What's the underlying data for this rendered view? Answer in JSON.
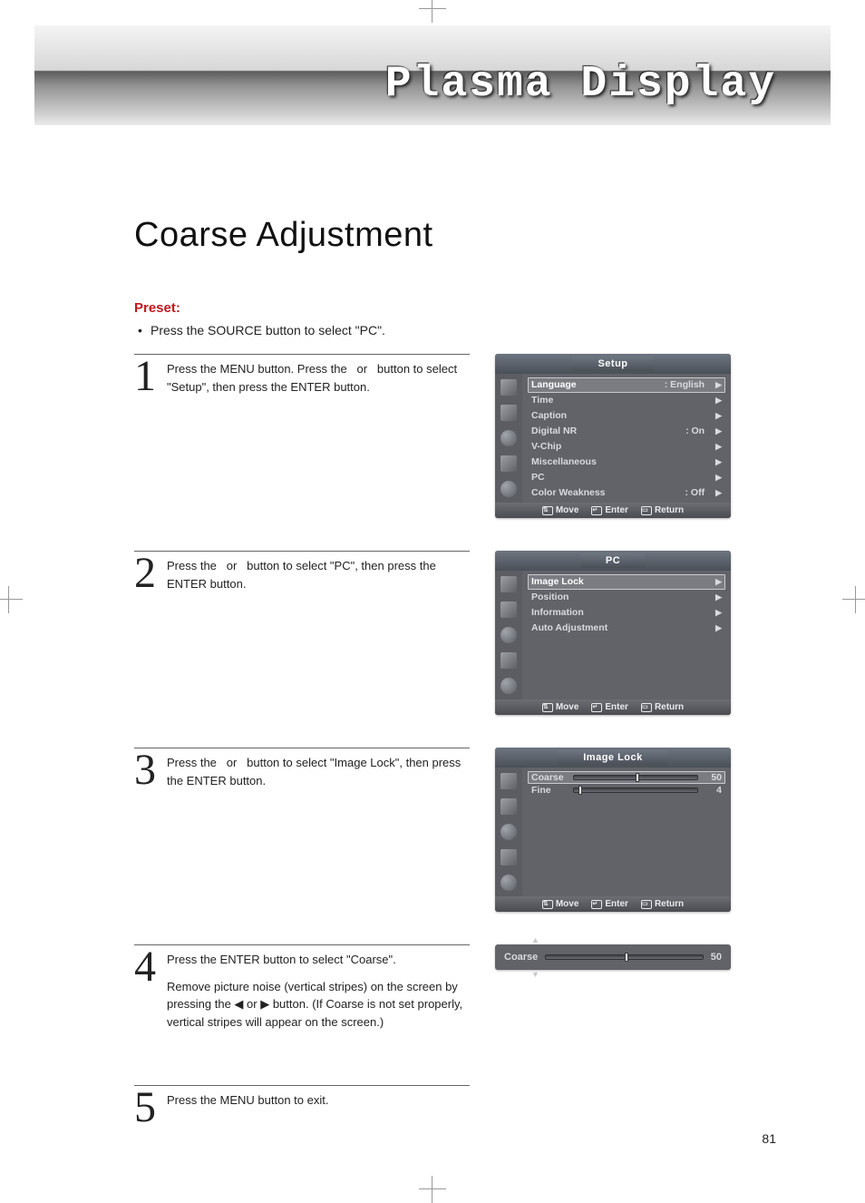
{
  "header": {
    "brand_text": "Plasma Display"
  },
  "section_title": "Coarse Adjustment",
  "preset": {
    "label": "Preset:",
    "text": "Press the SOURCE button to select \"PC\"."
  },
  "steps": [
    {
      "num": "1",
      "text": "Press the MENU button. Press the   or   button to select \"Setup\", then press the ENTER button."
    },
    {
      "num": "2",
      "text": "Press the   or   button to select \"PC\", then press the ENTER button."
    },
    {
      "num": "3",
      "text": "Press the   or   button to select \"Image Lock\", then press the ENTER button."
    },
    {
      "num": "4",
      "text": "Press the ENTER button to select \"Coarse\".",
      "text2": "Remove picture noise (vertical stripes) on the screen by pressing the ◀ or ▶ button. (If Coarse is not set properly, vertical stripes will appear on the screen.)"
    },
    {
      "num": "5",
      "text": "Press the MENU button to exit."
    }
  ],
  "osd_setup": {
    "title": "Setup",
    "items": [
      {
        "label": "Language",
        "value": ": English",
        "highlight": true
      },
      {
        "label": "Time",
        "value": ""
      },
      {
        "label": "Caption",
        "value": ""
      },
      {
        "label": "Digital NR",
        "value": ": On"
      },
      {
        "label": "V-Chip",
        "value": ""
      },
      {
        "label": "Miscellaneous",
        "value": ""
      },
      {
        "label": "PC",
        "value": ""
      },
      {
        "label": "Color Weakness",
        "value": ": Off"
      }
    ]
  },
  "osd_pc": {
    "title": "PC",
    "items": [
      {
        "label": "Image Lock",
        "highlight": true
      },
      {
        "label": "Position"
      },
      {
        "label": "Information"
      },
      {
        "label": "Auto Adjustment"
      }
    ]
  },
  "osd_imagelock": {
    "title": "Image Lock",
    "sliders": [
      {
        "label": "Coarse",
        "value": 50,
        "pos": 50,
        "highlight": true
      },
      {
        "label": "Fine",
        "value": 4,
        "pos": 4
      }
    ]
  },
  "osd_footer": {
    "move": "Move",
    "enter": "Enter",
    "return": "Return"
  },
  "coarse_bar": {
    "label": "Coarse",
    "value": 50,
    "pos": 50
  },
  "page_number": "81"
}
